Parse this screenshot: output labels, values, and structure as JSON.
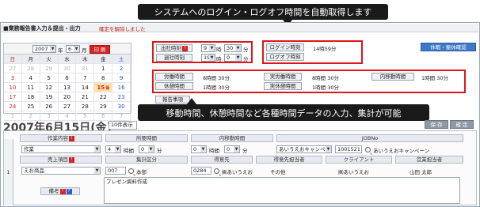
{
  "callouts": {
    "top": "システムへのログイン・ログオフ時間を自動取得します",
    "middle": "移動時間、休憩時間など各種時間データの入力、集計が可能"
  },
  "window": {
    "title": "■業務報告書入力＆提出・出力",
    "warning": "確定を解除しました"
  },
  "calendar": {
    "year": "2007",
    "year_suffix": "年",
    "month": "6",
    "month_suffix": "月",
    "print_label": "印 刷",
    "dow": [
      "日",
      "月",
      "火",
      "水",
      "木",
      "金",
      "土"
    ],
    "weeks": [
      [
        "27",
        "28",
        "29",
        "30",
        "31",
        "1",
        "2"
      ],
      [
        "3",
        "4",
        "5",
        "6",
        "7",
        "8",
        "9"
      ],
      [
        "10",
        "11",
        "12",
        "13",
        "14",
        "15",
        "16"
      ],
      [
        "17",
        "18",
        "19",
        "20",
        "21",
        "22",
        "23"
      ],
      [
        "24",
        "25",
        "26",
        "27",
        "28",
        "29",
        "30"
      ],
      [
        "1",
        "2",
        "3",
        "4",
        "5",
        "6",
        "7"
      ]
    ],
    "today_day": "15",
    "today_mark": "保"
  },
  "attendance": {
    "clock_in_label": "出社時刻",
    "clock_in_hour": "9",
    "clock_in_min": "30",
    "clock_out_label": "退社時刻",
    "clock_out_hour": "19",
    "clock_out_min": "0",
    "hour_unit": "時",
    "min_unit": "分",
    "badge": "!"
  },
  "login": {
    "login_label": "ログイン時刻",
    "login_value": "14時59分",
    "logoff_label": "ログオフ時刻",
    "logoff_value": ""
  },
  "rest_button": "休暇・振休確認",
  "times": {
    "work_label": "労働時間",
    "work_value": "8時間 30分",
    "actual_work_label": "実労働時間",
    "actual_work_value": "8時間 30分",
    "move_label": "内移動時間",
    "move_value": "1時間 30分",
    "break_label": "休憩時間",
    "break_value": "1時間 30分",
    "actual_break_label": "実休憩時間",
    "actual_break_value": "1時間 30分"
  },
  "report_label": "報告事項",
  "date_header": {
    "date": "2007年6月15日(金)",
    "count_select": "10件表示",
    "btn1": "保 存",
    "btn2": "確 定"
  },
  "form": {
    "headers_row1": [
      "作業内容",
      "所要時間",
      "内移動時間",
      "JOBNo"
    ],
    "headers_row2": [
      "売上項目",
      "集計区分",
      "得意先",
      "得意先担当者",
      "クライアント",
      "営業担当者"
    ],
    "work_type": "作業",
    "req_hour": "4",
    "req_min": "0",
    "move_hour": "0",
    "move_min": "0",
    "hour_unit": "時間",
    "min_unit": "分",
    "job_select": "あいうえおキャンペーン",
    "job_no": "1001521",
    "job_name": "あいうえおキャンペーン",
    "sales_item": "えお商品",
    "summary_code": "007",
    "summary_name": "本部",
    "client_code": "0284",
    "client_name": "㈱あいうえお",
    "client_rep": "その他",
    "client_co": "㈱あいうえお",
    "sales_rep": "山田 太郎",
    "remarks_label": "備考",
    "remarks": "プレゼン資料作成",
    "row_num": "1"
  }
}
